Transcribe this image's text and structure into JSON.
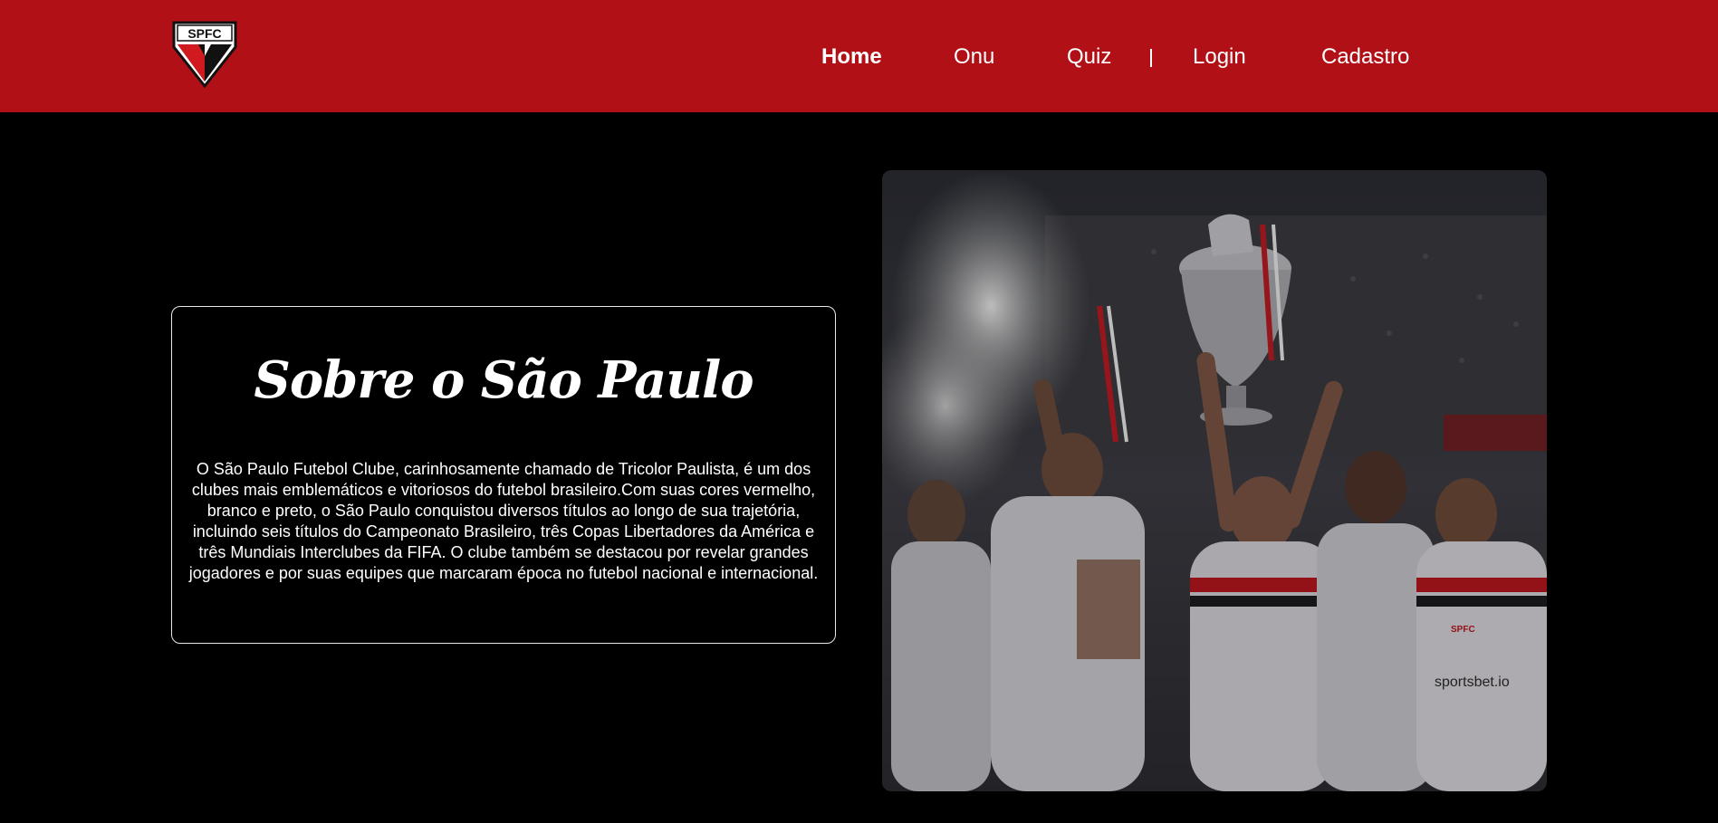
{
  "header": {
    "logo_text": "SPFC",
    "nav": [
      {
        "label": "Home",
        "active": true
      },
      {
        "label": "Onu",
        "active": false
      },
      {
        "label": "Quiz",
        "active": false
      },
      {
        "label": "Login",
        "active": false
      },
      {
        "label": "Cadastro",
        "active": false
      }
    ],
    "separator": "|"
  },
  "about": {
    "title": "Sobre o São Paulo",
    "text": "O São Paulo Futebol Clube, carinhosamente chamado de Tricolor Paulista, é um dos clubes mais emblemáticos e vitoriosos do futebol brasileiro.Com suas cores vermelho, branco e preto, o São Paulo conquistou diversos títulos ao longo de sua trajetória, incluindo seis títulos do Campeonato Brasileiro, três Copas Libertadores da América e três Mundiais Interclubes da FIFA. O clube também se destacou por revelar grandes jogadores e por suas equipes que marcaram época no futebol nacional e internacional."
  },
  "photo": {
    "shirt_sponsor": "sportsbet.io",
    "crest_text": "SPFC"
  },
  "colors": {
    "brand_red": "#b11116",
    "background": "#000000",
    "text": "#ffffff"
  }
}
